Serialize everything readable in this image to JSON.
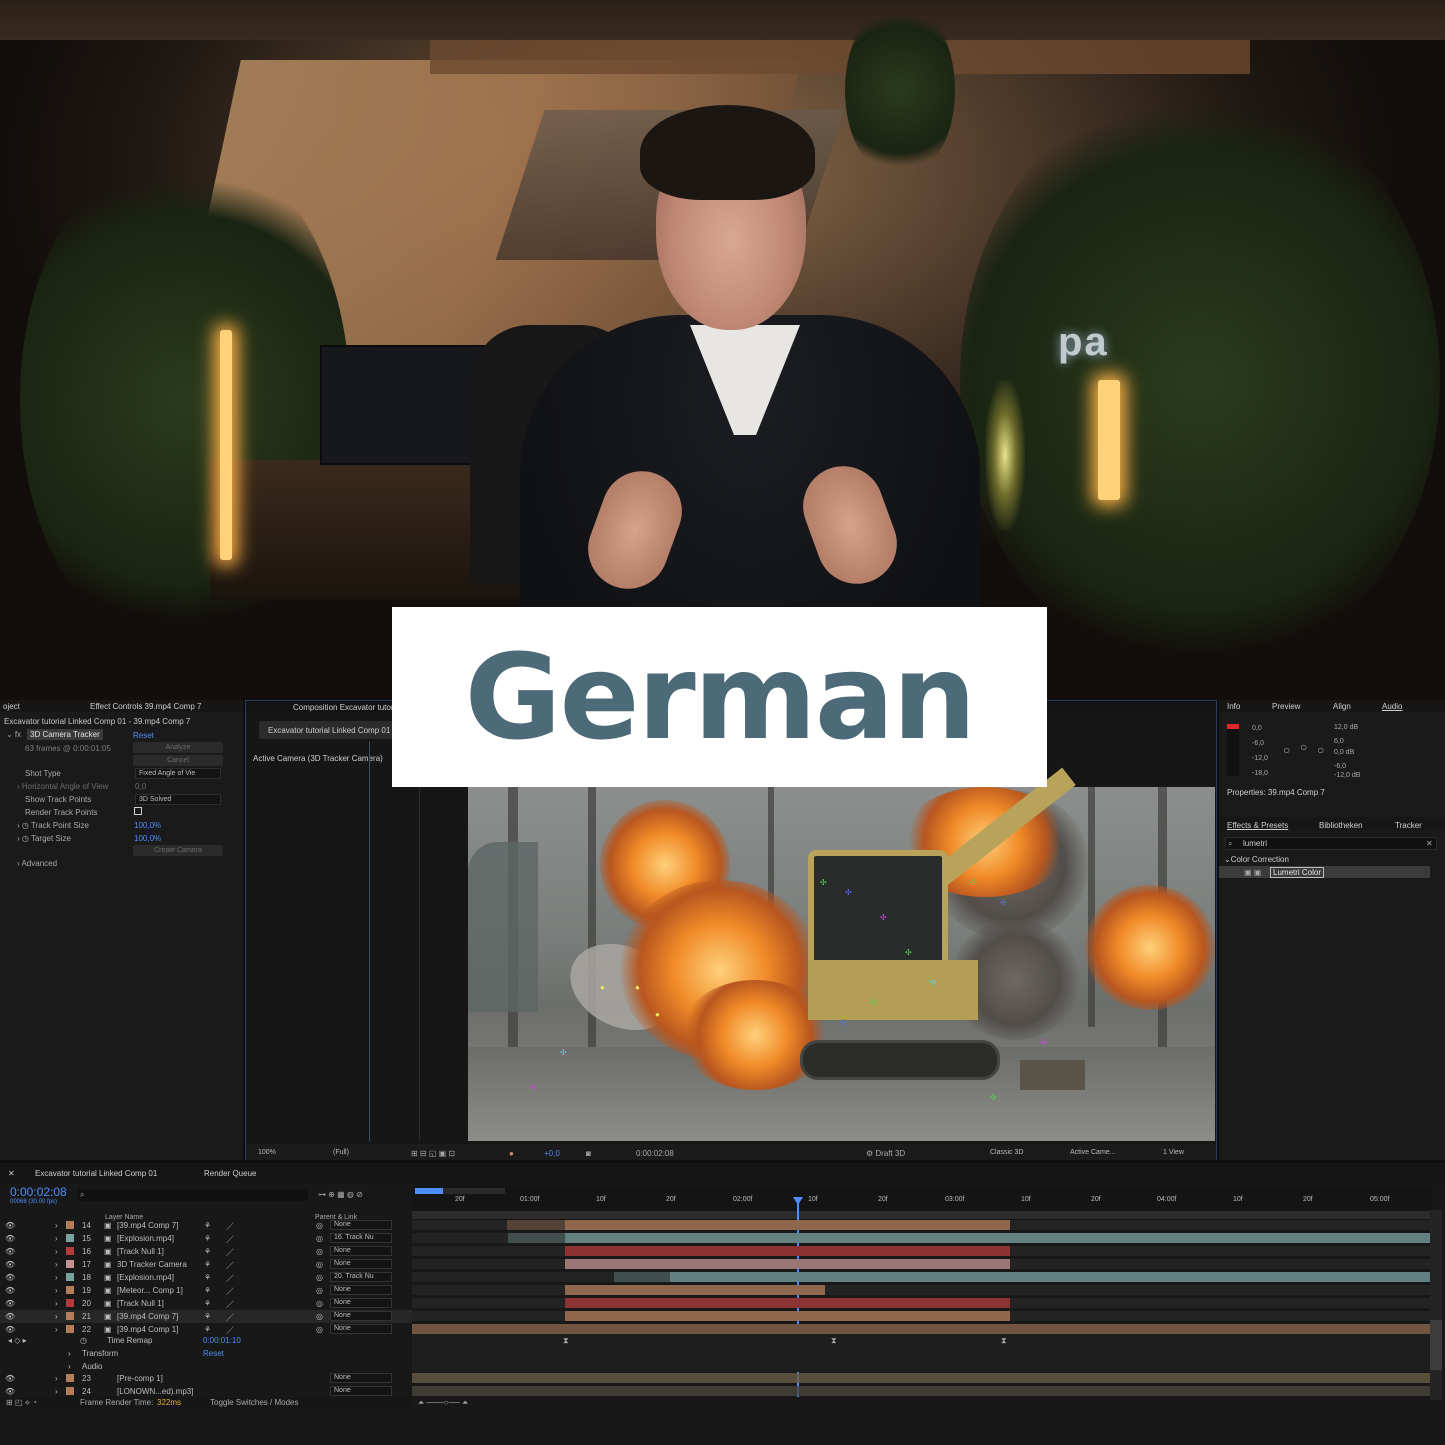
{
  "overlay": {
    "label": "German"
  },
  "photo": {
    "sign_text": "pa"
  },
  "effect_controls": {
    "tabs": [
      "oject",
      "Effect Controls 39.mp4 Comp 7"
    ],
    "layer_path": "Excavator tutorial Linked Comp 01 - 39.mp4 Comp 7",
    "effect_name": "3D Camera Tracker",
    "reset": "Reset",
    "frames_info": "63 frames @ 0:00:01:05",
    "analyze": "Analyze",
    "cancel": "Cancel",
    "props": [
      {
        "name": "Shot Type",
        "value": "Fixed Angle of Vie"
      },
      {
        "name": "Horizontal Angle of View",
        "value": "0,0"
      },
      {
        "name": "Show Track Points",
        "value": "3D Solved"
      },
      {
        "name": "Render Track Points",
        "value": ""
      },
      {
        "name": "Track Point Size",
        "value": "100,0%"
      },
      {
        "name": "Target Size",
        "value": "100,0%"
      }
    ],
    "create_camera": "Create Camera",
    "advanced": "Advanced"
  },
  "composition": {
    "tab": "Composition Excavator tutor",
    "comp_name": "Excavator tutorial Linked Comp 01",
    "camera_label": "Active Camera (3D Tracker Camera)",
    "footer": {
      "zoom": "100%",
      "resolution": "(Full)",
      "exposure": "+0,0",
      "timecode": "0:00:02:08",
      "renderer": "Draft 3D",
      "renderer_mode": "Classic 3D",
      "camera": "Active Came...",
      "views": "1 View"
    }
  },
  "right_panel": {
    "tabs_top": [
      "Info",
      "Preview",
      "Align",
      "Audio"
    ],
    "audio_levels_left": [
      "0,0",
      "-6,0",
      "-12,0",
      "-18,0"
    ],
    "audio_levels_right": [
      "12,0 dB",
      "6,0",
      "0,0 dB",
      "-6,0",
      "-12,0 dB"
    ],
    "properties": "Properties: 39.mp4 Comp 7",
    "tabs_mid": [
      "Effects & Presets",
      "Bibliotheken",
      "Tracker"
    ],
    "search_value": "lumetri",
    "category": "Color Correction",
    "effect_item": "Lumetri Color"
  },
  "timeline": {
    "tab": "Excavator tutorial Linked Comp 01",
    "render_queue": "Render Queue",
    "timecode": "0:00:02:08",
    "frame_info": "00068 (30.00 fps)",
    "search_placeholder": "",
    "header_layer_name": "Layer Name",
    "header_parent": "Parent & Link",
    "ruler": [
      "20f",
      "01:00f",
      "10f",
      "20f",
      "02:00f",
      "10f",
      "20f",
      "03:00f",
      "10f",
      "20f",
      "04:00f",
      "10f",
      "20f",
      "05:00f"
    ],
    "layers": [
      {
        "num": "14",
        "name": "[39.mp4 Comp 7]",
        "parent": "None",
        "color": "#b37f5b"
      },
      {
        "num": "15",
        "name": "[Explosion.mp4]",
        "parent": "16. Track Nu",
        "color": "#78a2a0"
      },
      {
        "num": "16",
        "name": "[Track Null 1]",
        "parent": "None",
        "color": "#b33a3a"
      },
      {
        "num": "17",
        "name": "3D Tracker Camera",
        "parent": "None",
        "color": "#c59292"
      },
      {
        "num": "18",
        "name": "[Explosion.mp4]",
        "parent": "20. Track Nu",
        "color": "#78a2a0"
      },
      {
        "num": "19",
        "name": "[Meteor... Comp 1]",
        "parent": "None",
        "color": "#b37f5b"
      },
      {
        "num": "20",
        "name": "[Track Null 1]",
        "parent": "None",
        "color": "#b33a3a"
      },
      {
        "num": "21",
        "name": "[39.mp4 Comp 7]",
        "parent": "None",
        "color": "#b37f5b"
      },
      {
        "num": "22",
        "name": "[39.mp4 Comp 1]",
        "parent": "None",
        "color": "#b37f5b"
      }
    ],
    "time_remap": {
      "label": "Time Remap",
      "value": "0:00:01:10"
    },
    "transform": {
      "label": "Transform",
      "value": "Reset"
    },
    "audio": "Audio",
    "layers_bottom": [
      {
        "num": "23",
        "name": "[Pre-comp 1]",
        "parent": "None"
      },
      {
        "num": "24",
        "name": "[LONOWN...ed).mp3]",
        "parent": "None"
      }
    ],
    "frame_render_label": "Frame Render Time:",
    "frame_render_value": "322ms",
    "toggle": "Toggle Switches / Modes"
  }
}
